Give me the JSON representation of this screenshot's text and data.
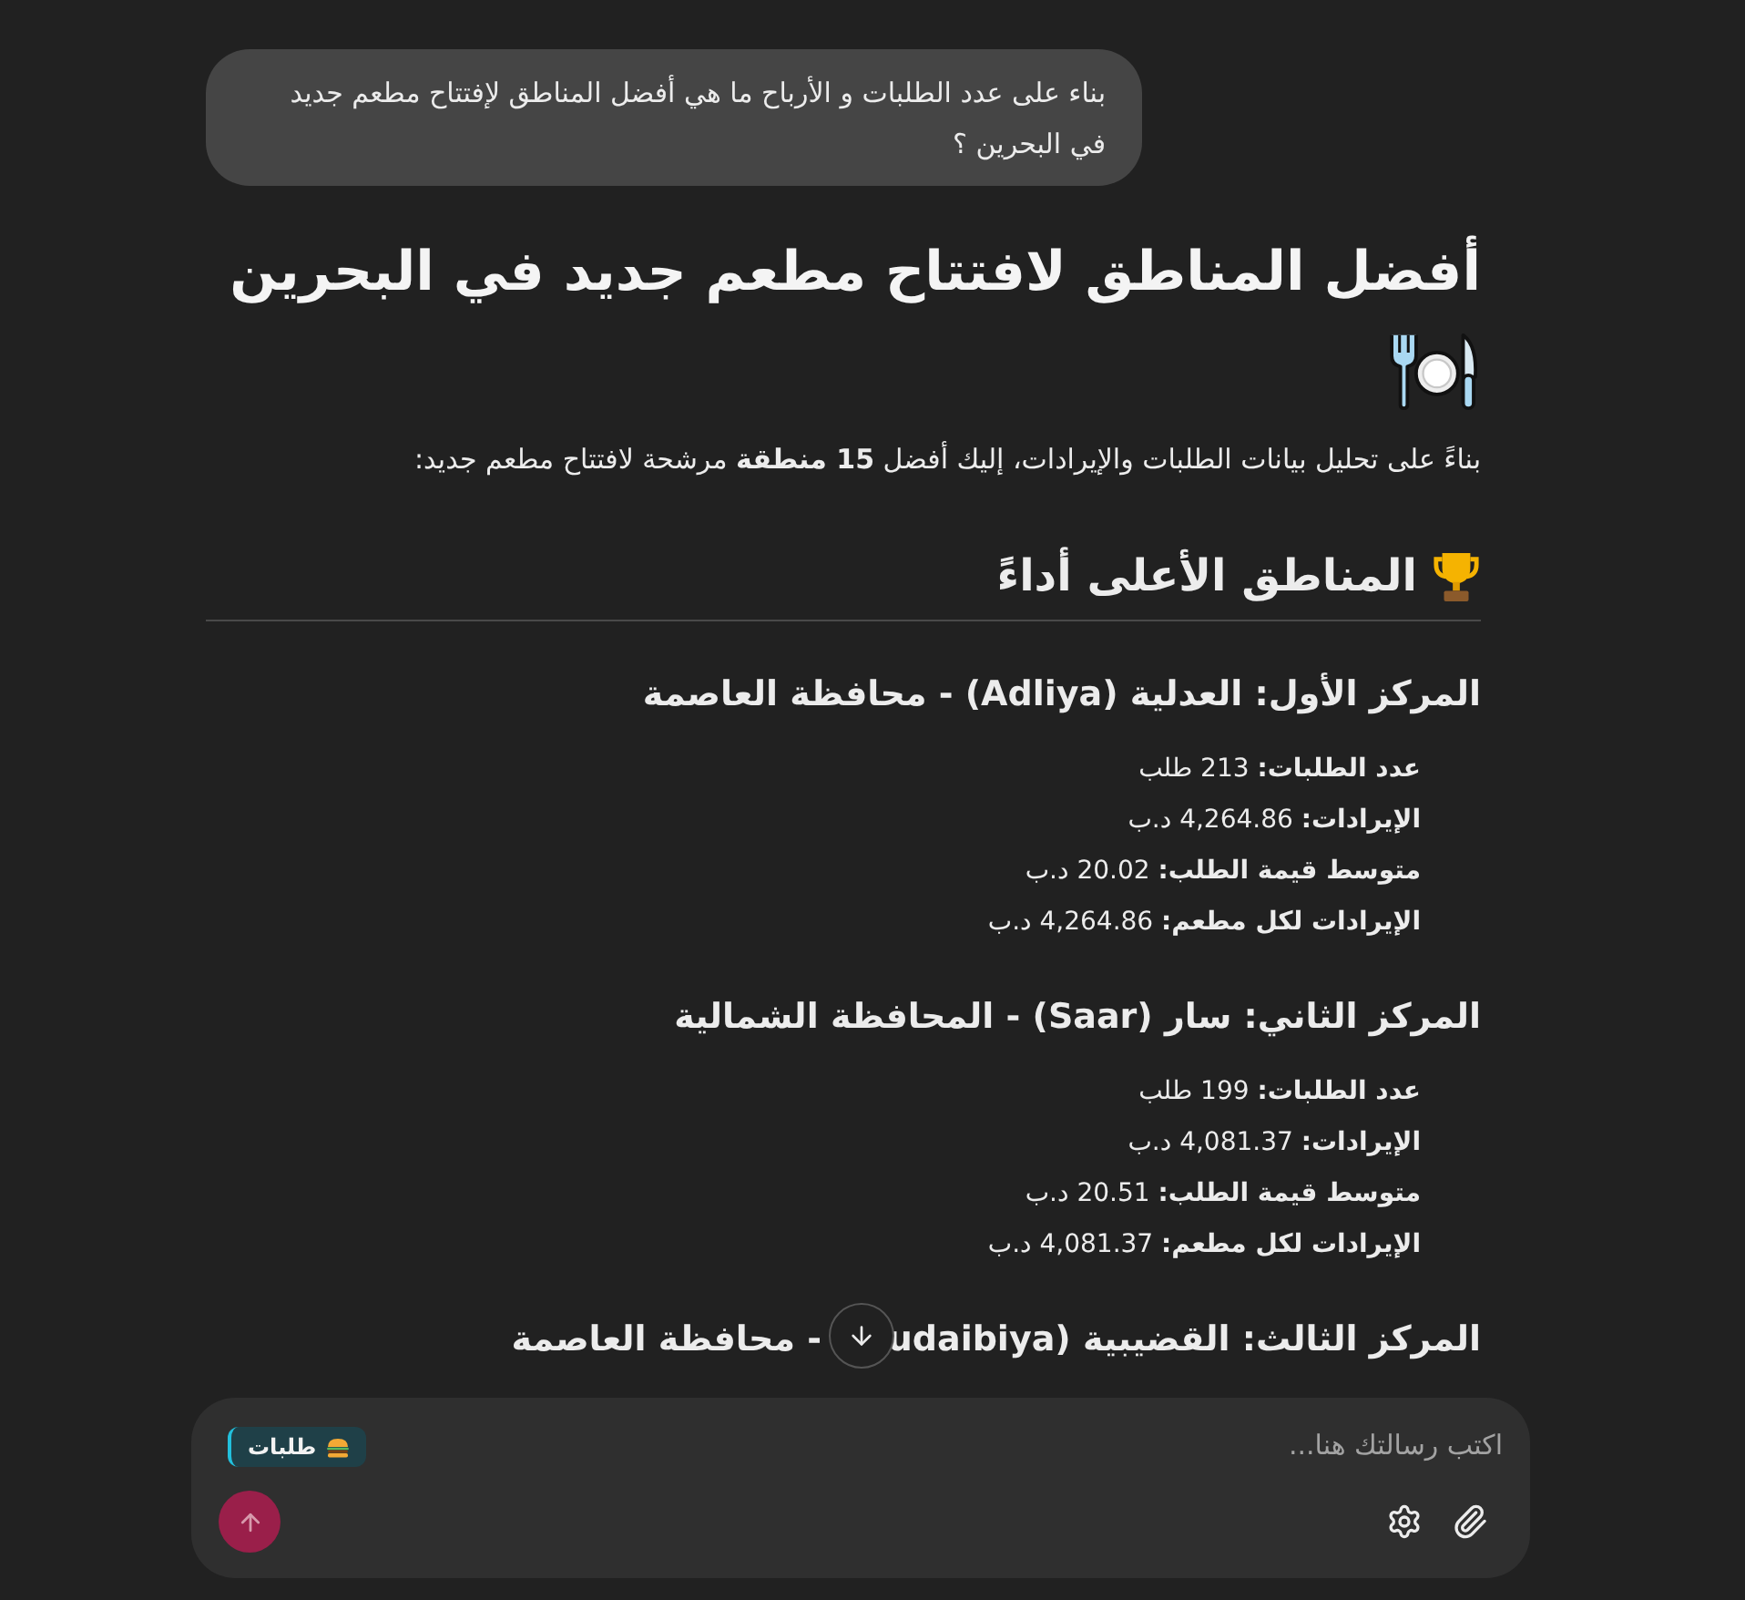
{
  "user_message": {
    "text": "بناء على عدد الطلبات و الأرباح ما هي أفضل المناطق لإفتتاح مطعم جديد في البحرين ؟"
  },
  "response": {
    "title": "أفضل المناطق لافتتاح مطعم جديد في البحرين",
    "intro": "بناءً على تحليل بيانات الطلبات والإيرادات، إليك أفضل **15 منطقة** مرشحة لافتتاح مطعم جديد:",
    "section": {
      "heading": "المناطق الأعلى أداءً"
    },
    "areas": [
      {
        "heading": "المركز الأول: العدلية (Adliya) - محافظة العاصمة",
        "stats": [
          {
            "label": "عدد الطلبات:",
            "value": "213 طلب"
          },
          {
            "label": "الإيرادات:",
            "value": "4,264.86 د.ب"
          },
          {
            "label": "متوسط قيمة الطلب:",
            "value": "20.02 د.ب"
          },
          {
            "label": "الإيرادات لكل مطعم:",
            "value": "4,264.86 د.ب"
          }
        ]
      },
      {
        "heading": "المركز الثاني: سار (Saar) - المحافظة الشمالية",
        "stats": [
          {
            "label": "عدد الطلبات:",
            "value": "199 طلب"
          },
          {
            "label": "الإيرادات:",
            "value": "4,081.37 د.ب"
          },
          {
            "label": "متوسط قيمة الطلب:",
            "value": "20.51 د.ب"
          },
          {
            "label": "الإيرادات لكل مطعم:",
            "value": "4,081.37 د.ب"
          }
        ]
      },
      {
        "heading_parts": [
          "المركز الثالث: القضيبية",
          "udaibiya)",
          "- محافظة العاصمة"
        ]
      }
    ]
  },
  "composer": {
    "placeholder": "اكتب رسالتك هنا...",
    "chip": {
      "label": "طلبات"
    }
  }
}
